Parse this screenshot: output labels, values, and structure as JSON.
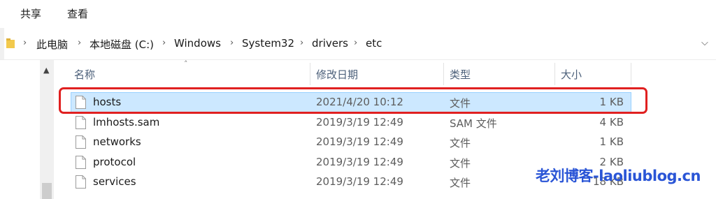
{
  "ribbon": {
    "tabs": [
      "共享",
      "查看"
    ]
  },
  "address": {
    "crumbs": [
      "此电脑",
      "本地磁盘 (C:)",
      "Windows",
      "System32",
      "drivers",
      "etc"
    ]
  },
  "columns": {
    "name": "名称",
    "date": "修改日期",
    "type": "类型",
    "size": "大小"
  },
  "files": [
    {
      "name": "hosts",
      "date": "2021/4/20 10:12",
      "type": "文件",
      "size": "1 KB",
      "selected": true
    },
    {
      "name": "lmhosts.sam",
      "date": "2019/3/19 12:49",
      "type": "SAM 文件",
      "size": "4 KB"
    },
    {
      "name": "networks",
      "date": "2019/3/19 12:49",
      "type": "文件",
      "size": "1 KB"
    },
    {
      "name": "protocol",
      "date": "2019/3/19 12:49",
      "type": "文件",
      "size": "2 KB"
    },
    {
      "name": "services",
      "date": "2019/3/19 12:49",
      "type": "文件",
      "size": "18 KB"
    }
  ],
  "watermark": "老刘博客-laoliublog.cn",
  "colors": {
    "selection": "#cce8ff",
    "highlight_border": "#e02020",
    "watermark": "#2a55d6"
  },
  "icons": [
    "folder-icon",
    "chevron-right-icon",
    "chevron-down-icon",
    "file-icon",
    "scroll-up-icon",
    "sort-up-icon"
  ]
}
